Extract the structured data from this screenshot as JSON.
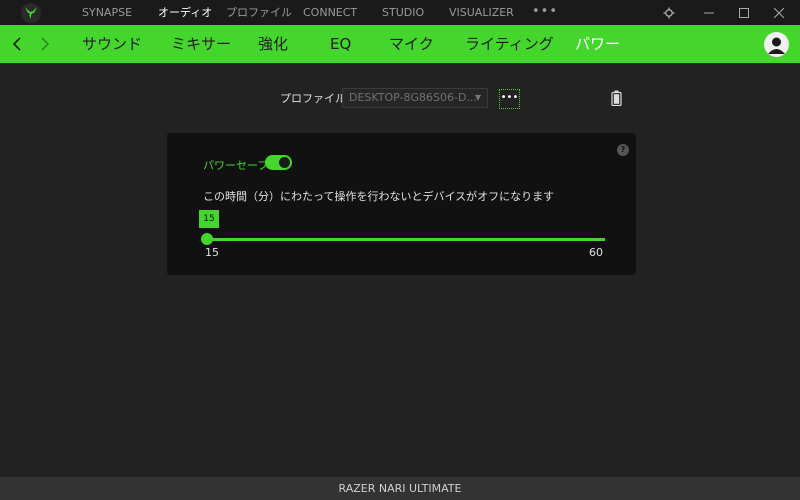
{
  "topnav": {
    "items": [
      "SYNAPSE",
      "オーディオ",
      "プロファイル",
      "CONNECT",
      "STUDIO",
      "VISUALIZER"
    ],
    "active_index": 1,
    "more": "•••"
  },
  "window_controls": {
    "settings": "gear-icon",
    "minimize": "minimize-icon",
    "maximize": "maximize-icon",
    "close": "close-icon"
  },
  "tabs": {
    "items": [
      "サウンド",
      "ミキサー",
      "強化",
      "EQ",
      "マイク",
      "ライティング",
      "パワー"
    ],
    "active_index": 6
  },
  "profile": {
    "label": "プロファイル",
    "selected": "DESKTOP-8G86S06-D...",
    "more": "•••"
  },
  "power": {
    "label": "パワーセーブ",
    "enabled": true,
    "description": "この時間（分）にわたって操作を行わないとデバイスがオフになります",
    "value": "15",
    "min": "15",
    "max": "60"
  },
  "help": "?",
  "footer": {
    "device": "RAZER NARI ULTIMATE"
  },
  "colors": {
    "accent": "#44d62c",
    "background": "#222222",
    "card": "#111111",
    "titlebar": "#1a1a1a"
  }
}
